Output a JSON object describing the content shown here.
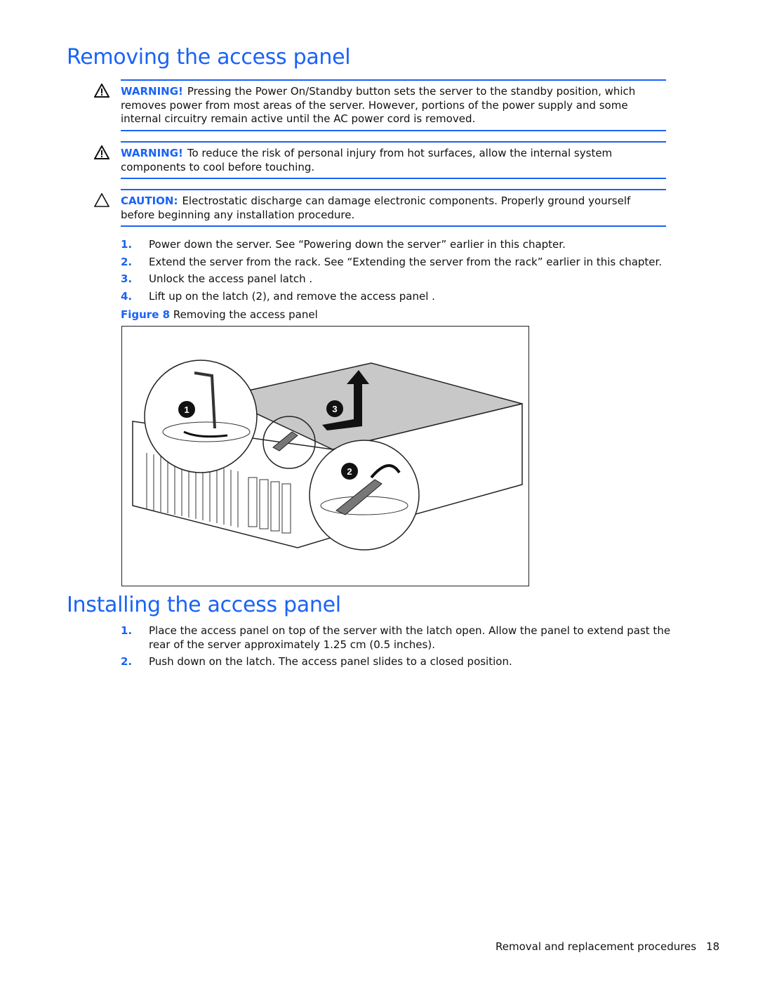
{
  "section1": {
    "title": "Removing the access panel",
    "notices": [
      {
        "type": "warning",
        "icon": "warning-triangle-icon",
        "label": "WARNING!",
        "text": "Pressing the Power On/Standby button sets the server to the standby position, which removes power from most areas of the server. However, portions of the power supply and some internal circuitry remain active until the AC power cord is removed."
      },
      {
        "type": "warning",
        "icon": "warning-triangle-icon",
        "label": "WARNING!",
        "text": "To reduce the risk of personal injury from hot surfaces, allow the internal system components to cool before touching."
      },
      {
        "type": "caution",
        "icon": "caution-triangle-icon",
        "label": "CAUTION:",
        "text": "Electrostatic discharge can damage electronic components. Properly ground yourself before beginning any installation procedure."
      }
    ],
    "steps": [
      {
        "num": "1.",
        "text": "Power down the server. See “Powering down the server” earlier in this chapter."
      },
      {
        "num": "2.",
        "text": "Extend the server from the rack. See “Extending the server from the rack” earlier in this chapter."
      },
      {
        "num": "3.",
        "text": "Unlock the access panel latch ."
      },
      {
        "num": "4.",
        "text": "Lift up on the latch (2), and remove the access panel ."
      }
    ],
    "figure": {
      "label": "Figure 8",
      "caption": "Removing the access panel",
      "callouts": [
        "1",
        "2",
        "3"
      ]
    }
  },
  "section2": {
    "title": "Installing the access panel",
    "steps": [
      {
        "num": "1.",
        "text": "Place the access panel on top of the server with the latch open. Allow the panel to extend past the rear of the server approximately 1.25 cm (0.5 inches)."
      },
      {
        "num": "2.",
        "text": "Push down on the latch. The access panel slides to a closed position."
      }
    ]
  },
  "footer": {
    "text": "Removal and replacement procedures",
    "page": "18"
  },
  "colors": {
    "accent": "#1a63f5"
  }
}
